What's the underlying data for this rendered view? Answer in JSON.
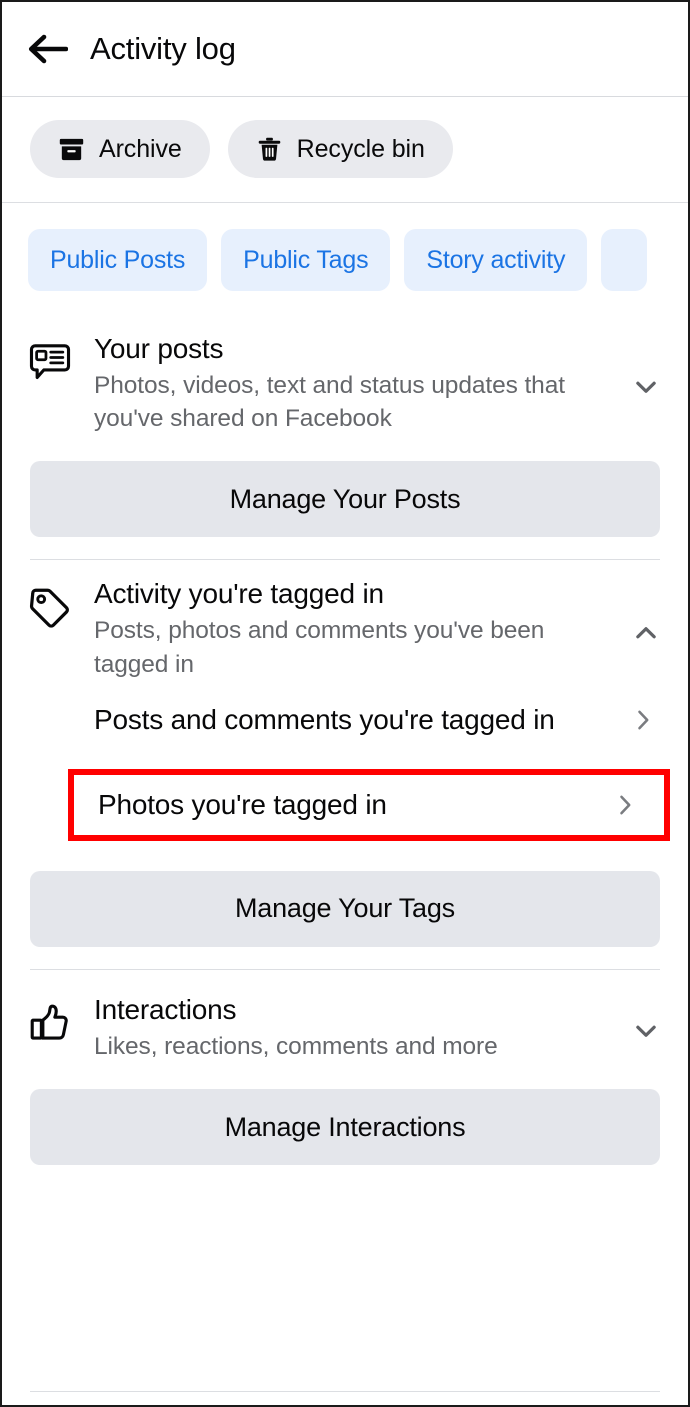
{
  "header": {
    "back_icon": "arrow-left-icon",
    "title": "Activity log"
  },
  "toolbar": {
    "buttons": [
      {
        "label": "Archive",
        "icon": "archive-box-icon"
      },
      {
        "label": "Recycle bin",
        "icon": "trash-icon"
      }
    ]
  },
  "filters": {
    "chips": [
      {
        "label": "Public Posts"
      },
      {
        "label": "Public Tags"
      },
      {
        "label": "Story activity"
      },
      {
        "label": ""
      }
    ],
    "chip_bg": "#E7F0FD",
    "chip_text": "#1B74E4"
  },
  "sections": [
    {
      "id": "your-posts",
      "icon": "post-bubble-icon",
      "title": "Your posts",
      "subtitle": "Photos, videos, text and status updates that you've shared on Facebook",
      "chevron": "chevron-down-icon",
      "expanded": false,
      "manage_label": "Manage Your Posts"
    },
    {
      "id": "activity-tagged-in",
      "icon": "tag-icon",
      "title": "Activity you're tagged in",
      "subtitle": "Posts, photos and comments you've been tagged in",
      "chevron": "chevron-up-icon",
      "expanded": true,
      "items": [
        {
          "label": "Posts and comments you're tagged in",
          "chevron": "chevron-right-icon",
          "highlighted": false
        },
        {
          "label": "Photos you're tagged in",
          "chevron": "chevron-right-icon",
          "highlighted": true
        }
      ],
      "manage_label": "Manage Your Tags"
    },
    {
      "id": "interactions",
      "icon": "thumbs-up-icon",
      "title": "Interactions",
      "subtitle": "Likes, reactions, comments and more",
      "chevron": "chevron-down-icon",
      "expanded": false,
      "manage_label": "Manage Interactions"
    }
  ],
  "colors": {
    "accent_blue": "#1B74E4",
    "gray_button": "#E4E6EB",
    "pill_gray": "#E9EAEE",
    "secondary_text": "#65676B",
    "highlight_red": "#FF0000"
  }
}
